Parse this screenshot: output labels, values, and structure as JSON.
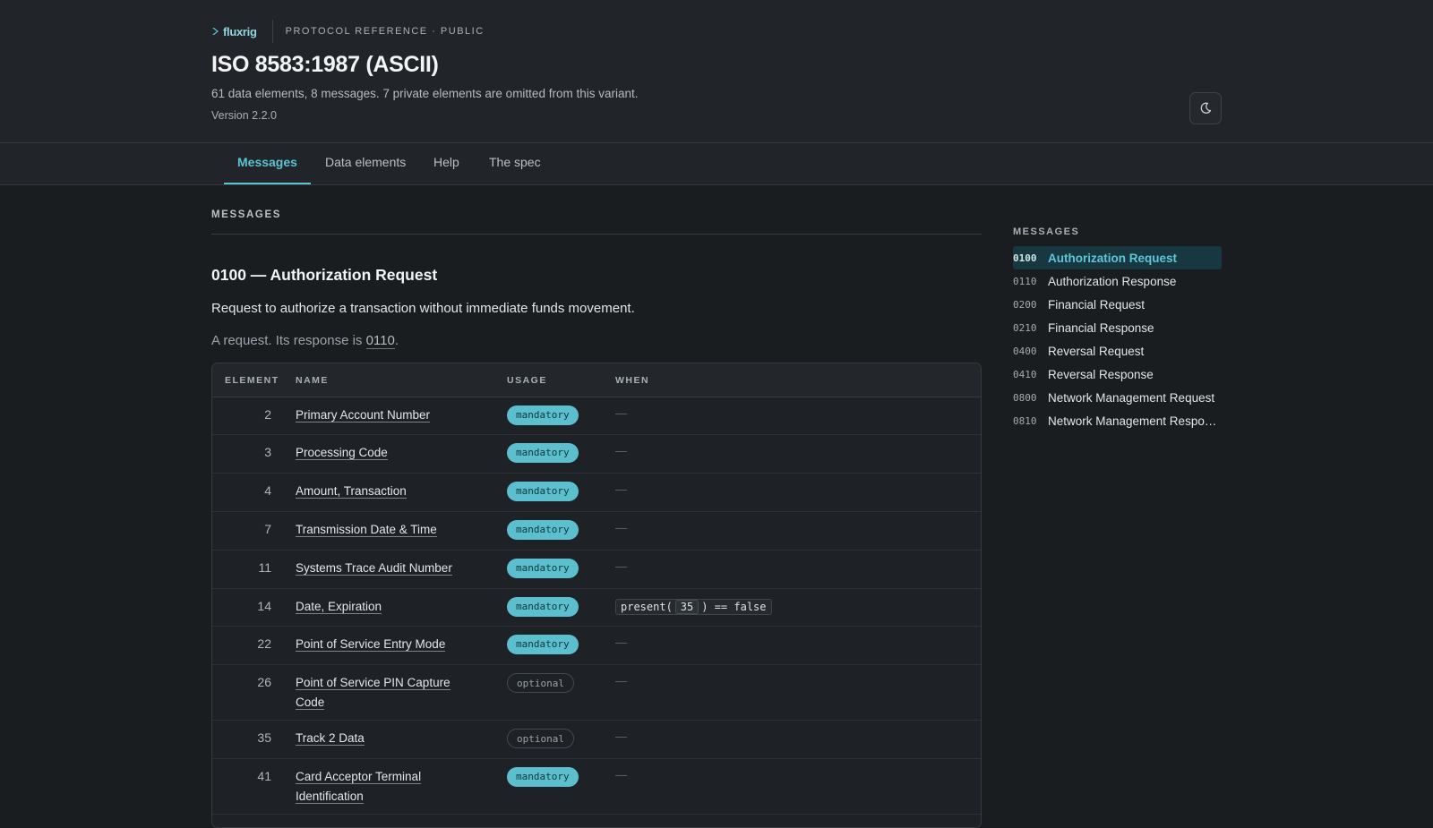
{
  "header": {
    "logo_text": "fluxrig",
    "breadcrumb": "PROTOCOL REFERENCE · PUBLIC",
    "title": "ISO 8583:1987 (ASCII)",
    "subtitle": "61 data elements, 8 messages. 7 private elements are omitted from this variant.",
    "version": "Version 2.2.0",
    "theme_toggle_icon": "moon-icon"
  },
  "tabs": [
    {
      "label": "Messages",
      "active": true
    },
    {
      "label": "Data elements",
      "active": false
    },
    {
      "label": "Help",
      "active": false
    },
    {
      "label": "The spec",
      "active": false
    }
  ],
  "main": {
    "section_label": "MESSAGES",
    "message": {
      "heading": "0100 — Authorization Request",
      "description": "Request to authorize a transaction without immediate funds movement.",
      "note_prefix": "A request. Its response is ",
      "note_link": "0110",
      "note_suffix": "."
    },
    "table": {
      "headers": {
        "element": "ELEMENT",
        "name": "NAME",
        "usage": "USAGE",
        "when": "WHEN"
      },
      "rows": [
        {
          "element": "2",
          "name": "Primary Account Number",
          "usage": "mandatory",
          "when": "—"
        },
        {
          "element": "3",
          "name": "Processing Code",
          "usage": "mandatory",
          "when": "—"
        },
        {
          "element": "4",
          "name": "Amount, Transaction",
          "usage": "mandatory",
          "when": "—"
        },
        {
          "element": "7",
          "name": "Transmission Date & Time",
          "usage": "mandatory",
          "when": "—"
        },
        {
          "element": "11",
          "name": "Systems Trace Audit Number",
          "usage": "mandatory",
          "when": "—"
        },
        {
          "element": "14",
          "name": "Date, Expiration",
          "usage": "mandatory",
          "when_code": {
            "before": "present(",
            "ref": "35",
            "after": ") == false"
          }
        },
        {
          "element": "22",
          "name": "Point of Service Entry Mode",
          "usage": "mandatory",
          "when": "—"
        },
        {
          "element": "26",
          "name": "Point of Service PIN Capture Code",
          "usage": "optional",
          "when": "—"
        },
        {
          "element": "35",
          "name": "Track 2 Data",
          "usage": "optional",
          "when": "—"
        },
        {
          "element": "41",
          "name": "Card Acceptor Terminal Identification",
          "usage": "mandatory",
          "when": "—"
        }
      ]
    }
  },
  "sidebar": {
    "label": "MESSAGES",
    "items": [
      {
        "code": "0100",
        "name": "Authorization Request",
        "active": true
      },
      {
        "code": "0110",
        "name": "Authorization Response",
        "active": false
      },
      {
        "code": "0200",
        "name": "Financial Request",
        "active": false
      },
      {
        "code": "0210",
        "name": "Financial Response",
        "active": false
      },
      {
        "code": "0400",
        "name": "Reversal Request",
        "active": false
      },
      {
        "code": "0410",
        "name": "Reversal Response",
        "active": false
      },
      {
        "code": "0800",
        "name": "Network Management Request",
        "active": false
      },
      {
        "code": "0810",
        "name": "Network Management Response",
        "active": false
      }
    ]
  },
  "colors": {
    "accent": "#5cc3d2",
    "mandatory_badge": "#5bbfce",
    "background": "#1a1d20",
    "header_background": "#212529"
  }
}
